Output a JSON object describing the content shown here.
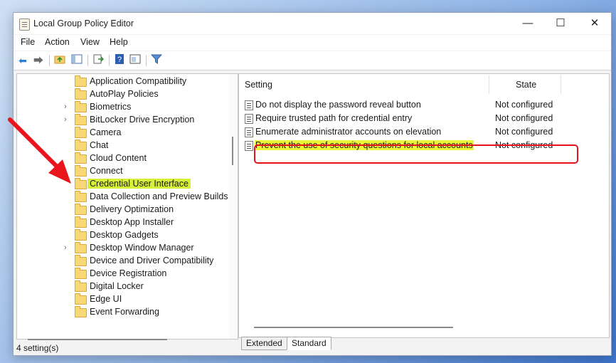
{
  "window": {
    "title": "Local Group Policy Editor",
    "controls": {
      "minimize": "—",
      "maximize": "☐",
      "close": "✕"
    }
  },
  "menu": [
    "File",
    "Action",
    "View",
    "Help"
  ],
  "toolbar_icons": [
    "back-arrow-icon",
    "forward-arrow-icon",
    "up-folder-icon",
    "show-hide-tree-icon",
    "export-list-icon",
    "help-icon",
    "properties-icon",
    "filter-icon"
  ],
  "tree": {
    "items": [
      {
        "label": "Application Compatibility",
        "expandable": false
      },
      {
        "label": "AutoPlay Policies",
        "expandable": false
      },
      {
        "label": "Biometrics",
        "expandable": true
      },
      {
        "label": "BitLocker Drive Encryption",
        "expandable": true
      },
      {
        "label": "Camera",
        "expandable": false
      },
      {
        "label": "Chat",
        "expandable": false
      },
      {
        "label": "Cloud Content",
        "expandable": false
      },
      {
        "label": "Connect",
        "expandable": false
      },
      {
        "label": "Credential User Interface",
        "expandable": false,
        "selected": true
      },
      {
        "label": "Data Collection and Preview Builds",
        "expandable": false
      },
      {
        "label": "Delivery Optimization",
        "expandable": false
      },
      {
        "label": "Desktop App Installer",
        "expandable": false
      },
      {
        "label": "Desktop Gadgets",
        "expandable": false
      },
      {
        "label": "Desktop Window Manager",
        "expandable": true
      },
      {
        "label": "Device and Driver Compatibility",
        "expandable": false
      },
      {
        "label": "Device Registration",
        "expandable": false
      },
      {
        "label": "Digital Locker",
        "expandable": false
      },
      {
        "label": "Edge UI",
        "expandable": false
      },
      {
        "label": "Event Forwarding",
        "expandable": false
      }
    ]
  },
  "list": {
    "columns": {
      "setting": "Setting",
      "state": "State"
    },
    "rows": [
      {
        "setting": "Do not display the password reveal button",
        "state": "Not configured"
      },
      {
        "setting": "Require trusted path for credential entry",
        "state": "Not configured"
      },
      {
        "setting": "Enumerate administrator accounts on elevation",
        "state": "Not configured"
      },
      {
        "setting": "Prevent the use of security questions for local accounts",
        "state": "Not configured",
        "highlighted": true
      }
    ]
  },
  "tabs": {
    "extended": "Extended",
    "standard": "Standard",
    "active": "Standard"
  },
  "status": {
    "text": "4 setting(s)"
  },
  "colors": {
    "highlight": "#d6f03a",
    "annotation_red": "#e4131b",
    "arrow_red": "#e8161c"
  }
}
